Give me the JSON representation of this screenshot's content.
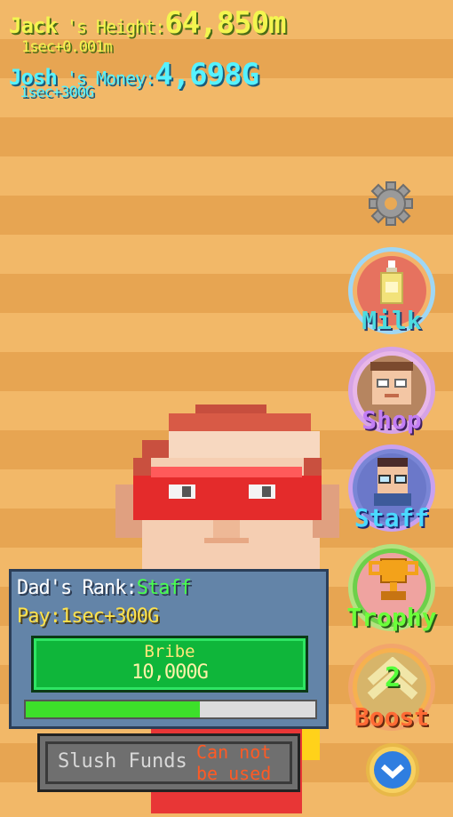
{
  "hud": {
    "height_name": "Jack",
    "height_label": " 's Height:",
    "height_value": "64,850m",
    "height_rate": "1sec+0.001m",
    "money_name": "Josh",
    "money_label": " 's Money:",
    "money_value": "4,698G",
    "money_rate": "1sec+300G"
  },
  "menu": {
    "items": [
      {
        "label": "Milk",
        "icon": "milk-bottle-icon"
      },
      {
        "label": "Shop",
        "icon": "shopkeeper-icon"
      },
      {
        "label": "Staff",
        "icon": "staff-man-icon"
      },
      {
        "label": "Trophy",
        "icon": "trophy-icon"
      },
      {
        "label": "2\nBoost",
        "icon": "boost-arrows-icon"
      }
    ],
    "boost_count": "2",
    "boost_label": "Boost",
    "settings_icon": "gear-icon",
    "collapse_icon": "check-chevron-icon"
  },
  "status": {
    "rank_label": "Dad's Rank:",
    "rank_value": "Staff",
    "pay": "Pay:1sec+300G",
    "bribe_label": "Bribe",
    "bribe_cost": "10,000G",
    "bribe_progress": 0.6
  },
  "slush": {
    "label": "Slush Funds",
    "warning_line1": "Can not",
    "warning_line2": "be used"
  },
  "colors": {
    "stripe_light": "#f2b868",
    "stripe_dark": "#e7a552",
    "hud_yellow": "#f3f54f",
    "hud_cyan": "#56f2ff",
    "panel": "#6384a8",
    "bribe_green": "#0fb63a",
    "rank_green": "#48ff4d",
    "warning_orange": "#ff5a24"
  }
}
